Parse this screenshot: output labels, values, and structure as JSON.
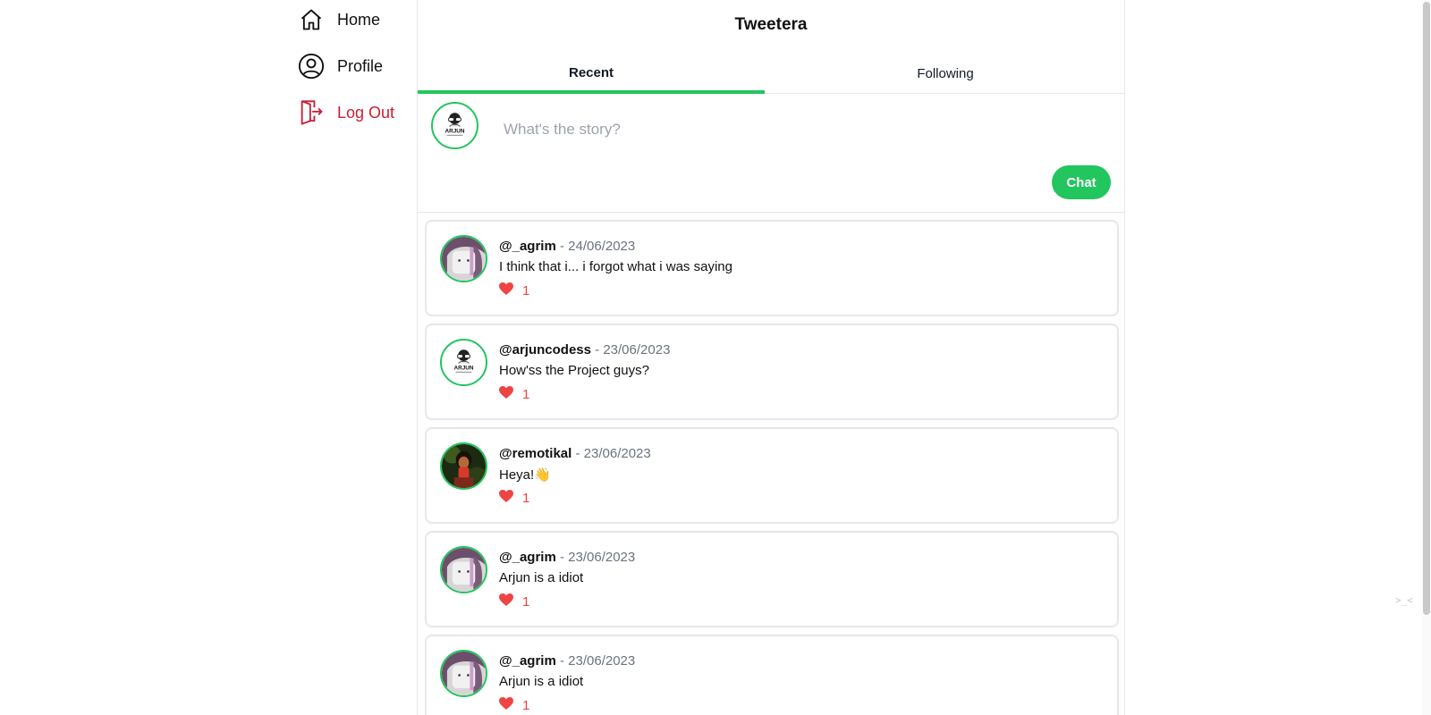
{
  "sidebar": {
    "items": [
      {
        "label": "Home",
        "icon": "home-icon"
      },
      {
        "label": "Profile",
        "icon": "user-circle-icon"
      },
      {
        "label": "Log Out",
        "icon": "logout-icon"
      }
    ]
  },
  "header": {
    "title": "Tweetera"
  },
  "tabs": [
    {
      "label": "Recent",
      "active": true
    },
    {
      "label": "Following",
      "active": false
    }
  ],
  "composer": {
    "placeholder": "What's the story?",
    "value": "",
    "submit_label": "Chat",
    "avatar_text": "ARJUN"
  },
  "posts": [
    {
      "handle": "@_agrim",
      "date": "- 24/06/2023",
      "text": "I think that i... i forgot what i was saying",
      "likes": "1",
      "avatar": "agrim"
    },
    {
      "handle": "@arjuncodess",
      "date": "- 23/06/2023",
      "text": "How'ss the Project guys?",
      "likes": "1",
      "avatar": "arjun"
    },
    {
      "handle": "@remotikal",
      "date": "- 23/06/2023",
      "text": "Heya!👋",
      "likes": "1",
      "avatar": "remotikal"
    },
    {
      "handle": "@_agrim",
      "date": "- 23/06/2023",
      "text": "Arjun is a idiot",
      "likes": "1",
      "avatar": "agrim"
    },
    {
      "handle": "@_agrim",
      "date": "- 23/06/2023",
      "text": "Arjun is a idiot",
      "likes": "1",
      "avatar": "agrim"
    }
  ],
  "colors": {
    "accent": "#22c55e",
    "logout": "#c81e32",
    "like": "#ef4444",
    "muted": "#6b7280"
  },
  "widget_text": ">_<"
}
